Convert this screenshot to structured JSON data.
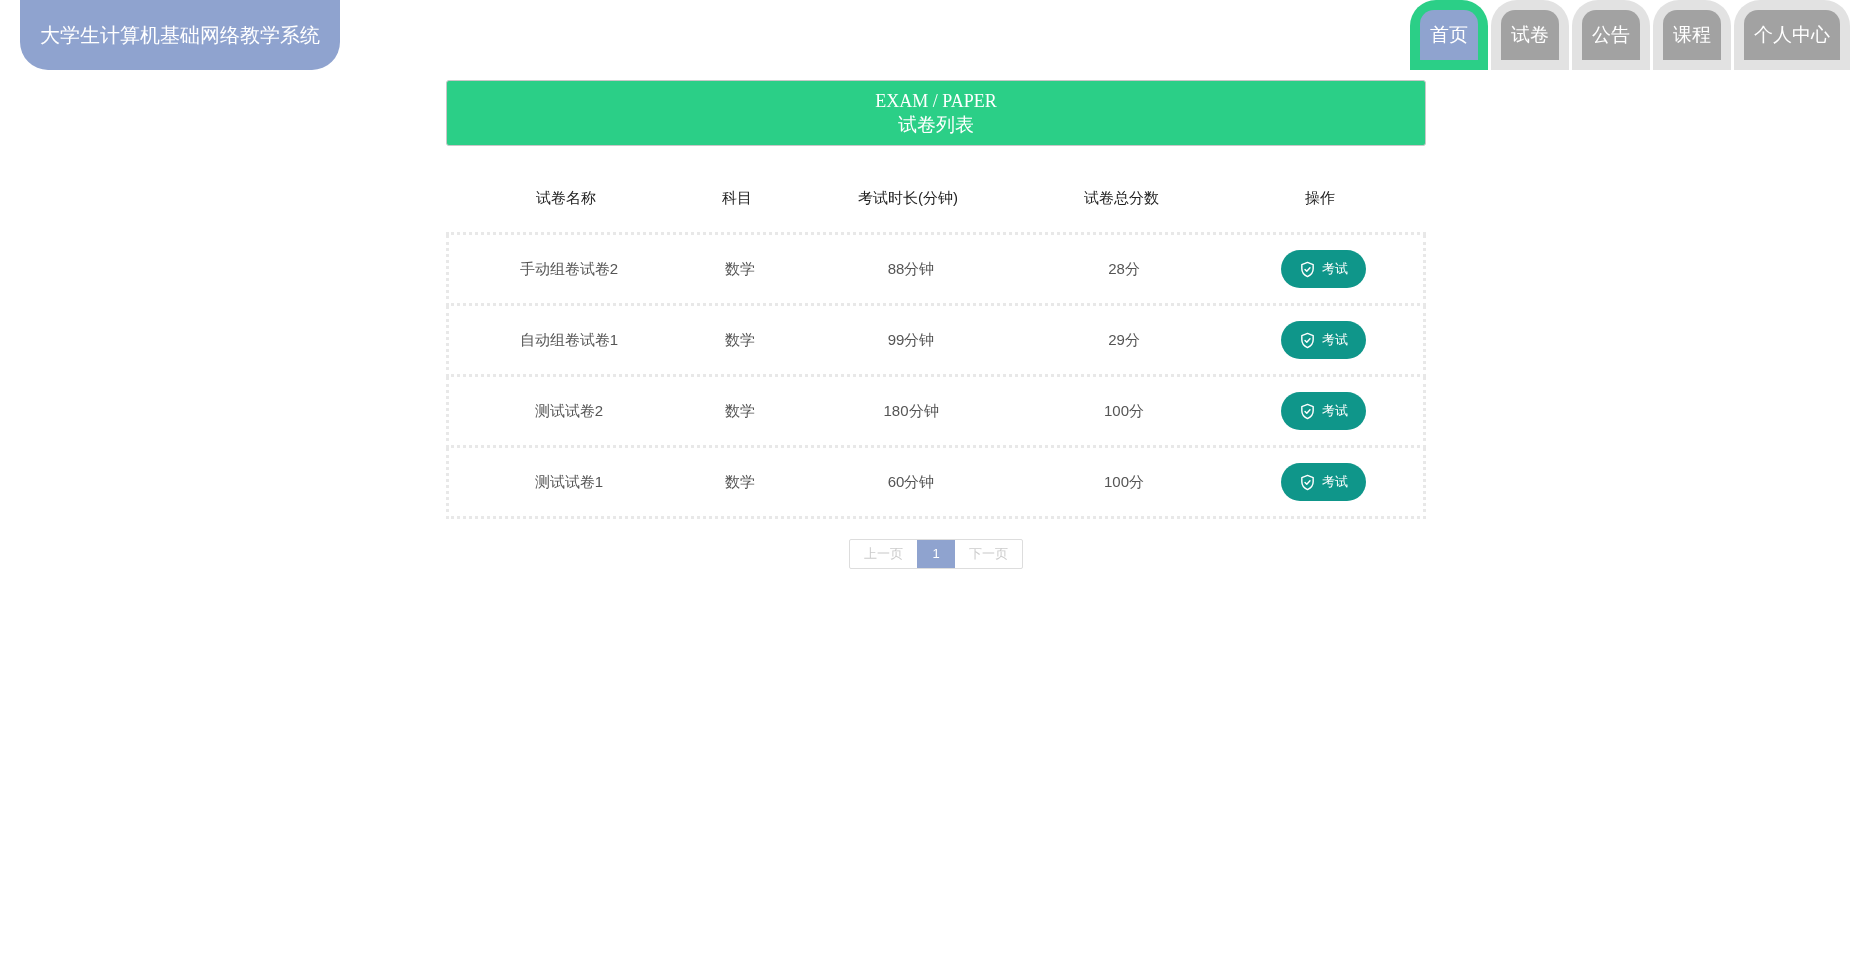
{
  "logo": "大学生计算机基础网络教学系统",
  "nav": [
    {
      "label": "首页",
      "selected": true
    },
    {
      "label": "试卷",
      "selected": false
    },
    {
      "label": "公告",
      "selected": false
    },
    {
      "label": "课程",
      "selected": false
    },
    {
      "label": "个人中心",
      "selected": false
    }
  ],
  "banner": {
    "title": "EXAM / PAPER",
    "subtitle": "试卷列表"
  },
  "table": {
    "columns": [
      "试卷名称",
      "科目",
      "考试时长(分钟)",
      "试卷总分数",
      "操作"
    ],
    "rows": [
      {
        "name": "手动组卷试卷2",
        "subject": "数学",
        "duration": "88分钟",
        "total_score": "28分",
        "action": "考试"
      },
      {
        "name": "自动组卷试卷1",
        "subject": "数学",
        "duration": "99分钟",
        "total_score": "29分",
        "action": "考试"
      },
      {
        "name": "测试试卷2",
        "subject": "数学",
        "duration": "180分钟",
        "total_score": "100分",
        "action": "考试"
      },
      {
        "name": "测试试卷1",
        "subject": "数学",
        "duration": "60分钟",
        "total_score": "100分",
        "action": "考试"
      }
    ]
  },
  "pagination": {
    "prev": {
      "label": "上一页",
      "disabled": true
    },
    "pages": [
      {
        "label": "1",
        "selected": true
      }
    ],
    "next": {
      "label": "下一页",
      "disabled": true
    }
  }
}
